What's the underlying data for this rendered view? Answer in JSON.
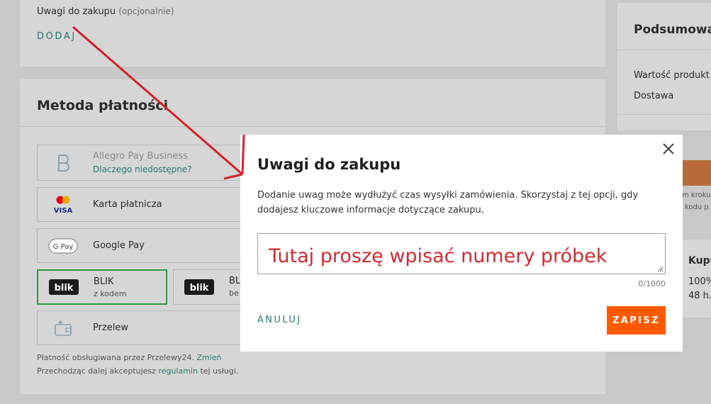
{
  "notes_section": {
    "label": "Uwagi do zakupu",
    "optional": "(opcjonalnie)",
    "add_label": "DODAJ"
  },
  "payment": {
    "title": "Metoda płatności",
    "options": [
      {
        "label": "Allegro Pay Business",
        "sub": "Dlaczego niedostępne?",
        "icon": "allegro-pay-icon"
      },
      {
        "label": "Karta płatnicza",
        "icon": "mastercard-visa-icon"
      },
      {
        "label": "Google Pay",
        "icon": "google-pay-icon"
      },
      {
        "label": "BLIK",
        "sub": "z kodem",
        "icon": "blik-icon"
      },
      {
        "label": "BL",
        "sub": "be",
        "icon": "blik-icon"
      },
      {
        "label": "Przelew",
        "icon": "wallet-icon"
      }
    ],
    "visa_text": "VISA",
    "gpay_text": "G Pay",
    "blik_text": "blik",
    "footnote1_text": "Płatność obsługiwana przez Przelewy24.",
    "footnote1_link": "Zmień",
    "footnote2_pre": "Przechodząc dalej akceptujesz",
    "footnote2_link": "regulamin",
    "footnote2_post": "tej usługi."
  },
  "summary": {
    "title": "Podsumowa",
    "row1": "Wartość produkt",
    "row2": "Dostawa",
    "small1": "m kroku",
    "small2": "kodu p",
    "card2_title": "Kupu",
    "card2_line1": "100%",
    "card2_line2": "48 h."
  },
  "dialog": {
    "title": "Uwagi do zakupu",
    "description": "Dodanie uwag może wydłużyć czas wysyłki zamówienia. Skorzystaj z tej opcji, gdy dodajesz kluczowe informacje dotyczące zakupu.",
    "textarea_value": "Tutaj proszę wpisać numery próbek",
    "counter": "0/1000",
    "cancel_label": "ANULUJ",
    "save_label": "ZAPISZ"
  },
  "colors": {
    "accent_orange": "#ff5a00",
    "link_teal": "#2a7a70",
    "annotation_red": "#d32a32",
    "blik_border_green": "#2f9a3a"
  }
}
